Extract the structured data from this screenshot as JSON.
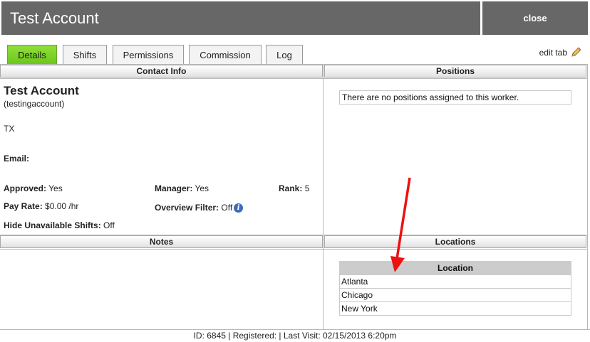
{
  "window": {
    "title": "Test Account",
    "close_label": "close"
  },
  "tabs": [
    {
      "label": "Details",
      "active": true
    },
    {
      "label": "Shifts",
      "active": false
    },
    {
      "label": "Permissions",
      "active": false
    },
    {
      "label": "Commission",
      "active": false
    },
    {
      "label": "Log",
      "active": false
    }
  ],
  "edit_tab_label": "edit tab",
  "sections": {
    "contact_info": "Contact Info",
    "positions": "Positions",
    "notes": "Notes",
    "locations": "Locations"
  },
  "contact": {
    "name": "Test Account",
    "username": "(testingaccount)",
    "state": "TX",
    "email_label": "Email:",
    "approved_label": "Approved:",
    "approved_value": "Yes",
    "manager_label": "Manager:",
    "manager_value": "Yes",
    "rank_label": "Rank:",
    "rank_value": "5",
    "pay_rate_label": "Pay Rate:",
    "pay_rate_value": "$0.00 /hr",
    "overview_filter_label": "Overview Filter:",
    "overview_filter_value": "Off",
    "hide_unavailable_label": "Hide Unavailable Shifts:",
    "hide_unavailable_value": "Off"
  },
  "positions": {
    "empty_message": "There are no positions assigned to this worker."
  },
  "locations": {
    "column_header": "Location",
    "rows": [
      "Atlanta",
      "Chicago",
      "New York"
    ]
  },
  "footer": {
    "text": "ID: 6845 | Registered: | Last Visit: 02/15/2013 6:20pm"
  },
  "colors": {
    "titlebar": "#676767",
    "active_tab": "#7ed321",
    "arrow": "#ee1111",
    "info_icon": "#3b6fb6"
  },
  "icons": {
    "edit": "pencil-icon",
    "info": "info-icon"
  }
}
